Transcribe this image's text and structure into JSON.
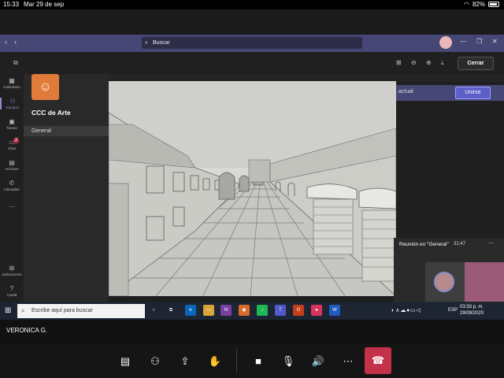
{
  "status_bar": {
    "time": "15:33",
    "date": "Mar 29 de sep",
    "battery": "82%"
  },
  "teams": {
    "search_placeholder": "Buscar",
    "close_label": "Cerrar",
    "team_name": "CCC de Arte",
    "channel": "General",
    "join_context": "actual",
    "join_label": "Unirse",
    "rail": [
      {
        "label": "Calendario",
        "icon": "calendar-icon"
      },
      {
        "label": "Equipos",
        "icon": "teams-icon"
      },
      {
        "label": "Tareas",
        "icon": "assignments-icon"
      },
      {
        "label": "Chat",
        "icon": "chat-icon",
        "badge": "2"
      },
      {
        "label": "Archivos",
        "icon": "files-icon"
      },
      {
        "label": "Llamadas",
        "icon": "calls-icon"
      },
      {
        "label": "...",
        "icon": "more-icon"
      },
      {
        "label": "Aplicaciones",
        "icon": "apps-icon"
      },
      {
        "label": "Ayuda",
        "icon": "help-icon"
      }
    ]
  },
  "meeting_window": {
    "title": "Reunión en \"General\"",
    "time": "31:47"
  },
  "taskbar": {
    "search_placeholder": "Escribe aquí para buscar",
    "lang": "ESP",
    "time": "03:33 p. m.",
    "date": "29/09/2020"
  },
  "presenter": {
    "name": "VERONICA G."
  },
  "call_controls": {
    "chat": "chat-icon",
    "participants": "participants-icon",
    "share": "share-screen-icon",
    "raise_hand": "raise-hand-icon",
    "camera": "camera-icon",
    "mic": "microphone-icon",
    "speaker": "speaker-icon",
    "more": "more-icon",
    "hangup": "hang-up-icon"
  },
  "colors": {
    "teams_purple": "#464775",
    "hangup_red": "#c4314b",
    "team_orange": "#e07b3a"
  }
}
